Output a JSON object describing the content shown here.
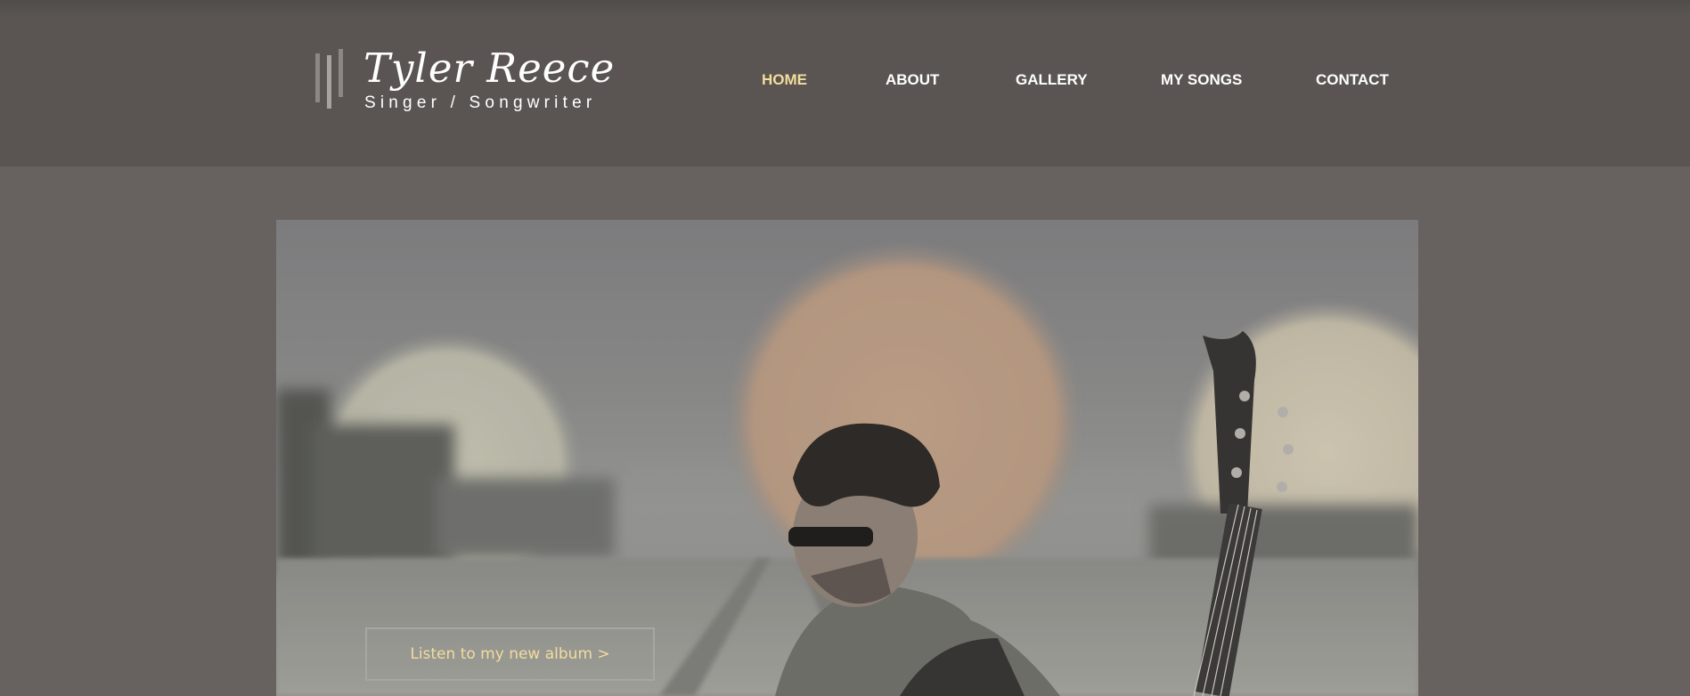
{
  "site": {
    "name": "Tyler Reece",
    "tagline": "Singer / Songwriter"
  },
  "nav": {
    "items": [
      {
        "label": "HOME",
        "active": true
      },
      {
        "label": "ABOUT",
        "active": false
      },
      {
        "label": "GALLERY",
        "active": false
      },
      {
        "label": "MY SONGS",
        "active": false
      },
      {
        "label": "CONTACT",
        "active": false
      }
    ]
  },
  "hero": {
    "cta_label": "Listen to my new album >"
  },
  "colors": {
    "header_bg": "#5a5552",
    "page_bg": "#67625f",
    "accent": "#f2dc9e",
    "nav_text": "#ffffff"
  }
}
